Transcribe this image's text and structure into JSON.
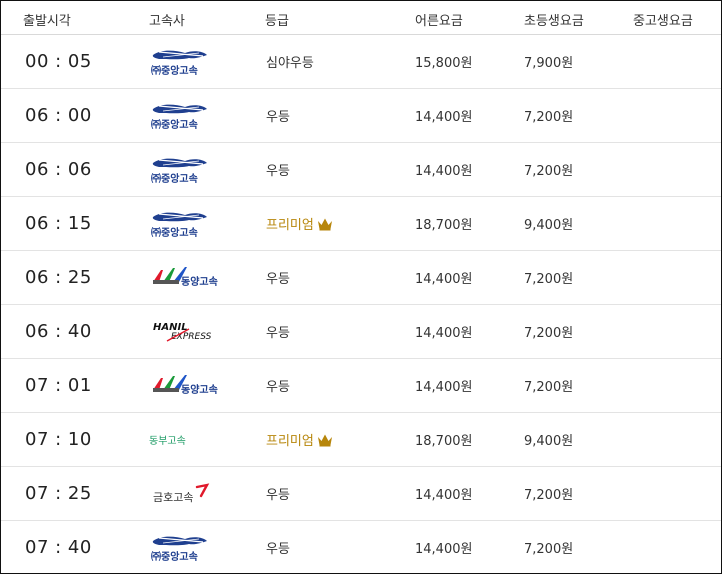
{
  "header": {
    "departure": "출발시각",
    "company": "고속사",
    "grade": "등급",
    "adult": "어른요금",
    "child": "초등생요금",
    "teen": "중고생요금"
  },
  "colors": {
    "premium": "#b7860b",
    "dongbu": "#1a9a63",
    "kumho_accent": "#e0192b",
    "jungang_blue": "#1f3f8f"
  },
  "rows": [
    {
      "time": "00 : 05",
      "company_logo": "jungang-logo",
      "company_text": "㈜중앙고속",
      "grade": "심야우등",
      "premium": false,
      "adult": "15,800원",
      "child": "7,900원",
      "teen": ""
    },
    {
      "time": "06 : 00",
      "company_logo": "jungang-logo",
      "company_text": "㈜중앙고속",
      "grade": "우등",
      "premium": false,
      "adult": "14,400원",
      "child": "7,200원",
      "teen": ""
    },
    {
      "time": "06 : 06",
      "company_logo": "jungang-logo",
      "company_text": "㈜중앙고속",
      "grade": "우등",
      "premium": false,
      "adult": "14,400원",
      "child": "7,200원",
      "teen": ""
    },
    {
      "time": "06 : 15",
      "company_logo": "jungang-logo",
      "company_text": "㈜중앙고속",
      "grade": "프리미엄",
      "premium": true,
      "adult": "18,700원",
      "child": "9,400원",
      "teen": ""
    },
    {
      "time": "06 : 25",
      "company_logo": "dongyang-logo",
      "company_text": "동양고속",
      "grade": "우등",
      "premium": false,
      "adult": "14,400원",
      "child": "7,200원",
      "teen": ""
    },
    {
      "time": "06 : 40",
      "company_logo": "hanil-logo",
      "company_text": "HANIL EXPRESS",
      "grade": "우등",
      "premium": false,
      "adult": "14,400원",
      "child": "7,200원",
      "teen": ""
    },
    {
      "time": "07 : 01",
      "company_logo": "dongyang-logo",
      "company_text": "동양고속",
      "grade": "우등",
      "premium": false,
      "adult": "14,400원",
      "child": "7,200원",
      "teen": ""
    },
    {
      "time": "07 : 10",
      "company_logo": "dongbu-logo",
      "company_text": "동부고속",
      "grade": "프리미엄",
      "premium": true,
      "adult": "18,700원",
      "child": "9,400원",
      "teen": ""
    },
    {
      "time": "07 : 25",
      "company_logo": "kumho-logo",
      "company_text": "금호고속",
      "grade": "우등",
      "premium": false,
      "adult": "14,400원",
      "child": "7,200원",
      "teen": ""
    },
    {
      "time": "07 : 40",
      "company_logo": "jungang-logo",
      "company_text": "㈜중앙고속",
      "grade": "우등",
      "premium": false,
      "adult": "14,400원",
      "child": "7,200원",
      "teen": ""
    }
  ]
}
